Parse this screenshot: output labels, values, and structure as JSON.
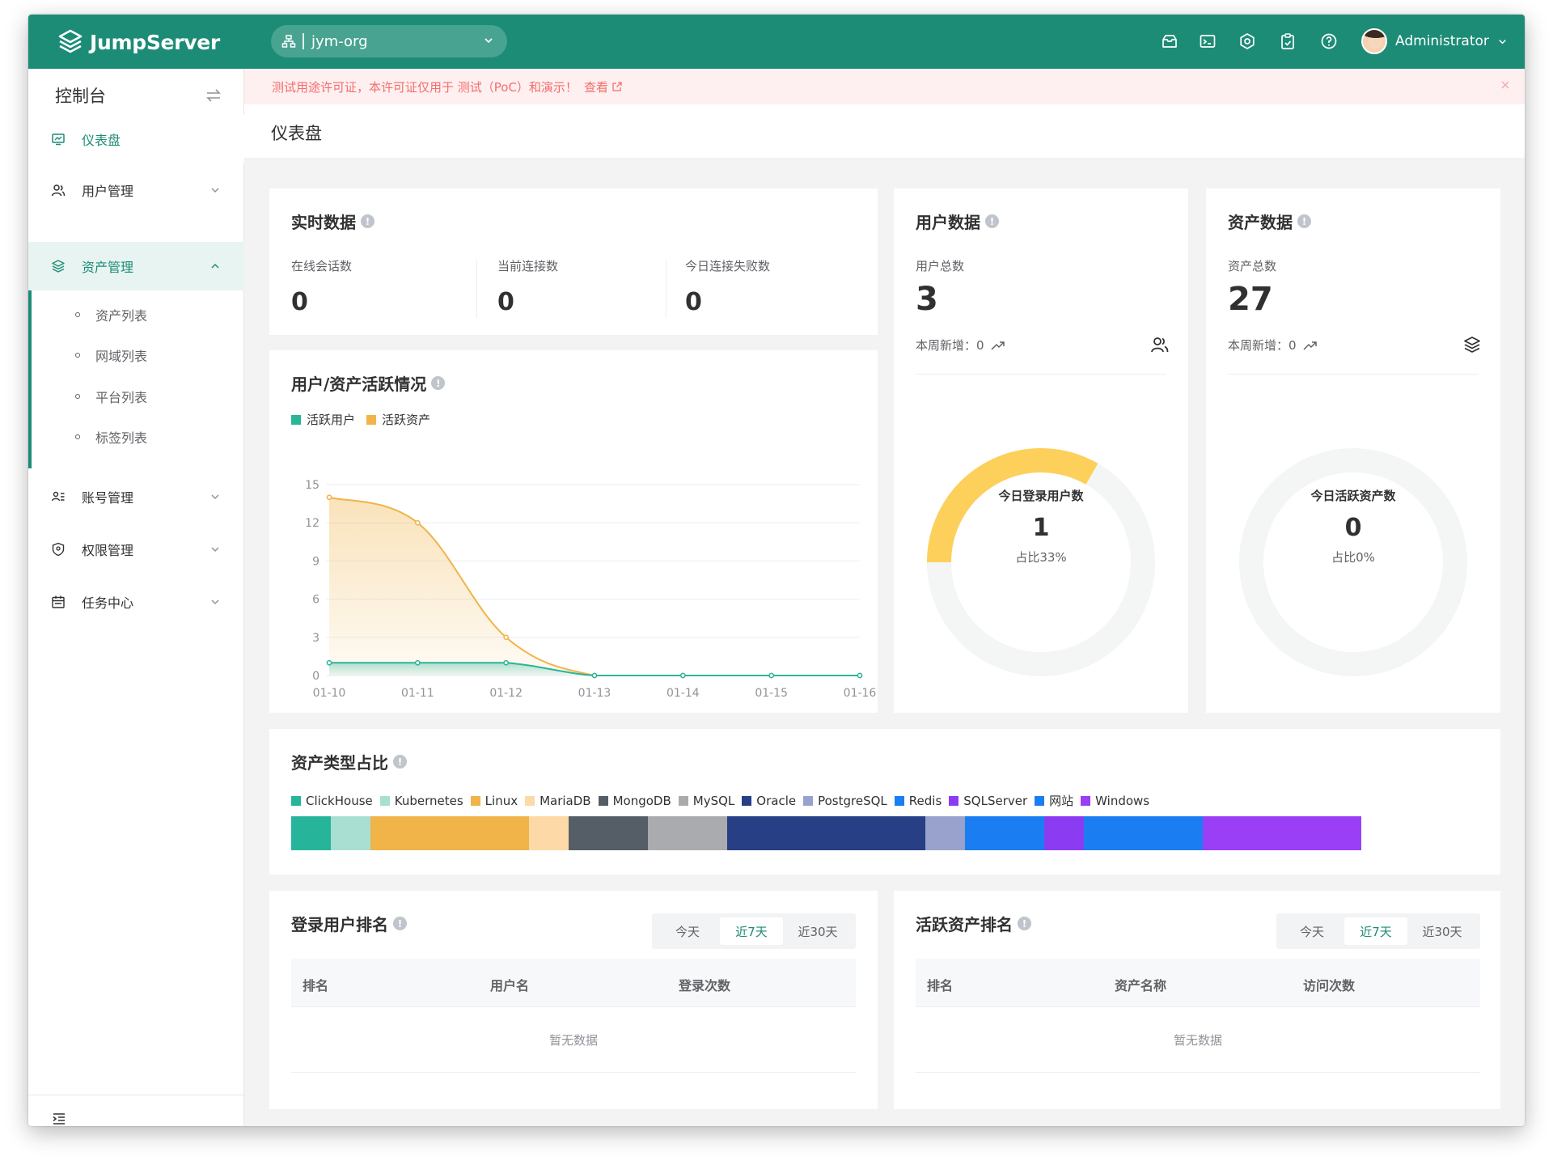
{
  "app": {
    "brand": "JumpServer",
    "org": "jym-org",
    "user": "Administrator"
  },
  "topbar_icons": [
    "mailbox-icon",
    "terminal-icon",
    "settings-icon",
    "clipboard-icon",
    "help-icon"
  ],
  "sidebar": {
    "title": "控制台",
    "items": [
      {
        "label": "仪表盘",
        "icon": "dashboard-icon"
      },
      {
        "label": "用户管理",
        "icon": "users-icon"
      },
      {
        "label": "资产管理",
        "icon": "layers-icon"
      },
      {
        "label": "账号管理",
        "icon": "account-icon"
      },
      {
        "label": "权限管理",
        "icon": "shield-icon"
      },
      {
        "label": "任务中心",
        "icon": "calendar-icon"
      }
    ],
    "subitems": [
      "资产列表",
      "网域列表",
      "平台列表",
      "标签列表"
    ]
  },
  "alert": {
    "text": "测试用途许可证，本许可证仅用于 测试（PoC）和演示！",
    "link": "查看"
  },
  "page_title": "仪表盘",
  "realtime": {
    "title": "实时数据",
    "stats": [
      {
        "label": "在线会话数",
        "value": "0"
      },
      {
        "label": "当前连接数",
        "value": "0"
      },
      {
        "label": "今日连接失败数",
        "value": "0"
      }
    ]
  },
  "user_data": {
    "title": "用户数据",
    "total_label": "用户总数",
    "total": "3",
    "week_label": "本周新增：",
    "week_value": "0",
    "donut_label": "今日登录用户数",
    "donut_value": "1",
    "donut_pct": "占比33%",
    "donut_fraction": 0.3333,
    "color": "#fdd05b"
  },
  "asset_data": {
    "title": "资产数据",
    "total_label": "资产总数",
    "total": "27",
    "week_label": "本周新增：",
    "week_value": "0",
    "donut_label": "今日活跃资产数",
    "donut_value": "0",
    "donut_pct": "占比0%",
    "donut_fraction": 0
  },
  "activity": {
    "title": "用户/资产活跃情况"
  },
  "chart_data": {
    "type": "area",
    "x": [
      "01-10",
      "01-11",
      "01-12",
      "01-13",
      "01-14",
      "01-15",
      "01-16"
    ],
    "series": [
      {
        "name": "活跃用户",
        "values": [
          1,
          1,
          1,
          0,
          0,
          0,
          0
        ],
        "color": "#2bb597"
      },
      {
        "name": "活跃资产",
        "values": [
          14,
          12,
          3,
          0,
          0,
          0,
          0
        ],
        "color": "#f0b449"
      }
    ],
    "yticks": [
      0,
      3,
      6,
      9,
      12,
      15
    ],
    "ylim": [
      0,
      15
    ],
    "grid": true,
    "legend": "top-left"
  },
  "asset_types": {
    "title": "资产类型占比",
    "types": [
      {
        "name": "ClickHouse",
        "color": "#26b59a",
        "share": 1
      },
      {
        "name": "Kubernetes",
        "color": "#a8dfd2",
        "share": 1
      },
      {
        "name": "Linux",
        "color": "#f0b449",
        "share": 4
      },
      {
        "name": "MariaDB",
        "color": "#fcd9a6",
        "share": 1
      },
      {
        "name": "MongoDB",
        "color": "#555e66",
        "share": 2
      },
      {
        "name": "MySQL",
        "color": "#a9abae",
        "share": 2
      },
      {
        "name": "Oracle",
        "color": "#263f85",
        "share": 5
      },
      {
        "name": "PostgreSQL",
        "color": "#98a2cc",
        "share": 1
      },
      {
        "name": "Redis",
        "color": "#1a7ef2",
        "share": 2
      },
      {
        "name": "SQLServer",
        "color": "#8b3cf2",
        "share": 1
      },
      {
        "name": "网站",
        "color": "#1a7ef2",
        "share": 3
      },
      {
        "name": "Windows",
        "color": "#9a3ff5",
        "share": 4
      }
    ]
  },
  "login_rank": {
    "title": "登录用户排名",
    "tabs": [
      "今天",
      "近7天",
      "近30天"
    ],
    "active_tab": "近7天",
    "columns": [
      "排名",
      "用户名",
      "登录次数"
    ],
    "empty": "暂无数据"
  },
  "asset_rank": {
    "title": "活跃资产排名",
    "tabs": [
      "今天",
      "近7天",
      "近30天"
    ],
    "active_tab": "近7天",
    "columns": [
      "排名",
      "资产名称",
      "访问次数"
    ],
    "empty": "暂无数据"
  }
}
